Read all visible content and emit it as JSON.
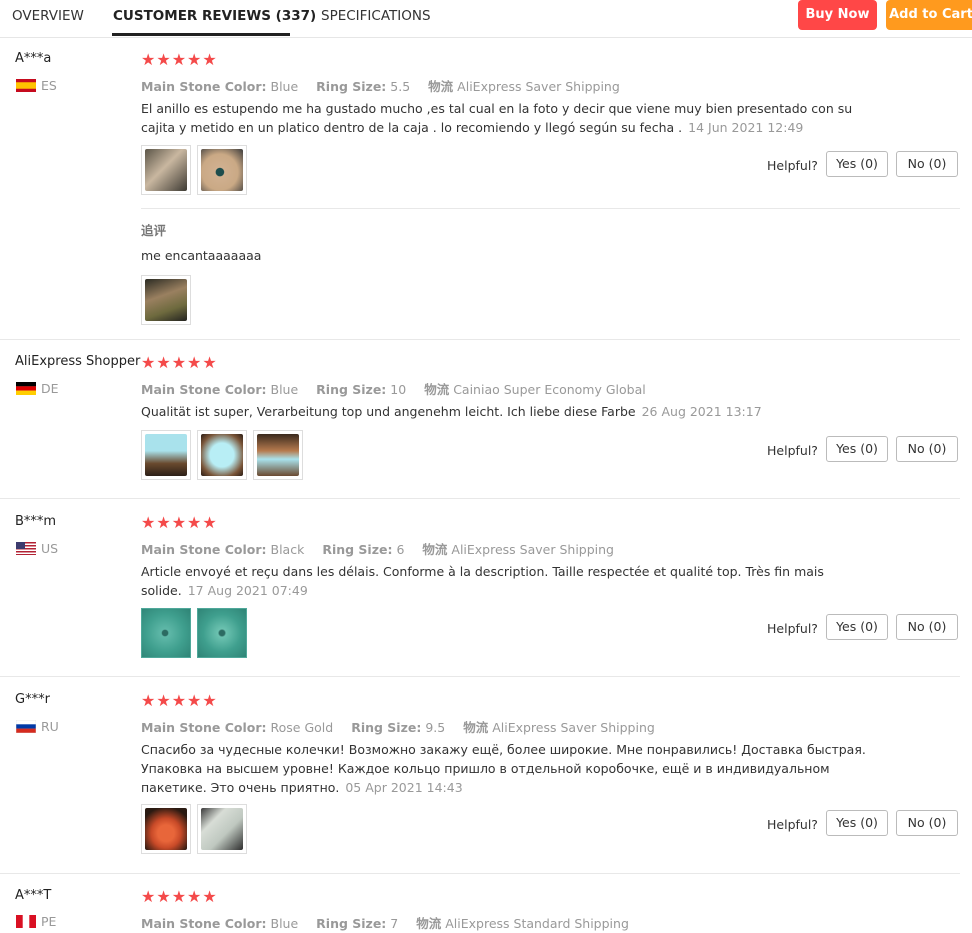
{
  "tabs": [
    {
      "label": "OVERVIEW"
    },
    {
      "label": "CUSTOMER REVIEWS (337)"
    },
    {
      "label": "SPECIFICATIONS"
    }
  ],
  "actions": {
    "buy_now": "Buy Now",
    "add_to_cart": "Add to Cart"
  },
  "colors": {
    "star": "#f44a4a",
    "buy_now": "#ff4747",
    "add_to_cart": "#ff9a1e"
  },
  "labels": {
    "main_stone": "Main Stone Color:",
    "ring_size": "Ring Size:",
    "logistics": "物流",
    "helpful": "Helpful?",
    "yes": "Yes (0)",
    "no": "No (0)",
    "stars": "★★★★★",
    "append_title": "追评"
  },
  "reviews": [
    {
      "user": "A***a",
      "country": "ES",
      "stone_color": "Blue",
      "ring_size": "5.5",
      "shipping": "AliExpress Saver Shipping",
      "text": "El anillo es estupendo me ha gustado mucho ,es tal cual en la foto y decir que viene muy bien presentado con su cajita y metido en un platico dentro de la caja . lo recomiendo y llegó según su fecha .",
      "date": "14 Jun 2021 12:49",
      "append_text": "me encantaaaaaaa"
    },
    {
      "user": "AliExpress Shopper",
      "country": "DE",
      "stone_color": "Blue",
      "ring_size": "10",
      "shipping": "Cainiao Super Economy Global",
      "text": "Qualität ist super, Verarbeitung top und angenehm leicht. Ich liebe diese Farbe",
      "date": "26 Aug 2021 13:17"
    },
    {
      "user": "B***m",
      "country": "US",
      "stone_color": "Black",
      "ring_size": "6",
      "shipping": "AliExpress Saver Shipping",
      "text": "Article envoyé et reçu dans les délais. Conforme à la description. Taille respectée et qualité top. Très fin mais solide.",
      "date": "17 Aug 2021 07:49"
    },
    {
      "user": "G***r",
      "country": "RU",
      "stone_color": "Rose Gold",
      "ring_size": "9.5",
      "shipping": "AliExpress Saver Shipping",
      "text": "Спасибо за чудесные колечки! Возможно закажу ещё, более широкие. Мне понравились! Доставка быстрая. Упаковка на высшем уровне! Каждое кольцо пришло в отдельной коробочке, ещё и в индивидуальном пакетике. Это очень приятно.",
      "date": "05 Apr 2021 14:43"
    },
    {
      "user": "A***T",
      "country": "PE",
      "stone_color": "Blue",
      "ring_size": "7",
      "shipping": "AliExpress Standard Shipping"
    }
  ]
}
